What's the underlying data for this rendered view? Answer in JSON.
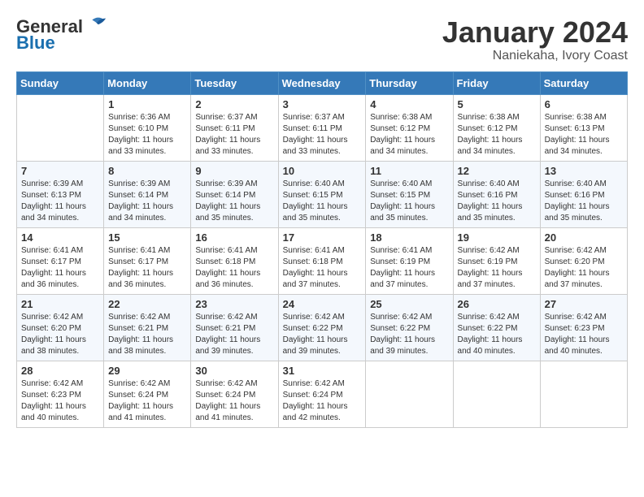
{
  "header": {
    "logo": {
      "general": "General",
      "blue": "Blue"
    },
    "title": "January 2024",
    "location": "Naniekaha, Ivory Coast"
  },
  "calendar": {
    "days_of_week": [
      "Sunday",
      "Monday",
      "Tuesday",
      "Wednesday",
      "Thursday",
      "Friday",
      "Saturday"
    ],
    "weeks": [
      [
        {
          "day": "",
          "info": ""
        },
        {
          "day": "1",
          "info": "Sunrise: 6:36 AM\nSunset: 6:10 PM\nDaylight: 11 hours\nand 33 minutes."
        },
        {
          "day": "2",
          "info": "Sunrise: 6:37 AM\nSunset: 6:11 PM\nDaylight: 11 hours\nand 33 minutes."
        },
        {
          "day": "3",
          "info": "Sunrise: 6:37 AM\nSunset: 6:11 PM\nDaylight: 11 hours\nand 33 minutes."
        },
        {
          "day": "4",
          "info": "Sunrise: 6:38 AM\nSunset: 6:12 PM\nDaylight: 11 hours\nand 34 minutes."
        },
        {
          "day": "5",
          "info": "Sunrise: 6:38 AM\nSunset: 6:12 PM\nDaylight: 11 hours\nand 34 minutes."
        },
        {
          "day": "6",
          "info": "Sunrise: 6:38 AM\nSunset: 6:13 PM\nDaylight: 11 hours\nand 34 minutes."
        }
      ],
      [
        {
          "day": "7",
          "info": "Sunrise: 6:39 AM\nSunset: 6:13 PM\nDaylight: 11 hours\nand 34 minutes."
        },
        {
          "day": "8",
          "info": "Sunrise: 6:39 AM\nSunset: 6:14 PM\nDaylight: 11 hours\nand 34 minutes."
        },
        {
          "day": "9",
          "info": "Sunrise: 6:39 AM\nSunset: 6:14 PM\nDaylight: 11 hours\nand 35 minutes."
        },
        {
          "day": "10",
          "info": "Sunrise: 6:40 AM\nSunset: 6:15 PM\nDaylight: 11 hours\nand 35 minutes."
        },
        {
          "day": "11",
          "info": "Sunrise: 6:40 AM\nSunset: 6:15 PM\nDaylight: 11 hours\nand 35 minutes."
        },
        {
          "day": "12",
          "info": "Sunrise: 6:40 AM\nSunset: 6:16 PM\nDaylight: 11 hours\nand 35 minutes."
        },
        {
          "day": "13",
          "info": "Sunrise: 6:40 AM\nSunset: 6:16 PM\nDaylight: 11 hours\nand 35 minutes."
        }
      ],
      [
        {
          "day": "14",
          "info": "Sunrise: 6:41 AM\nSunset: 6:17 PM\nDaylight: 11 hours\nand 36 minutes."
        },
        {
          "day": "15",
          "info": "Sunrise: 6:41 AM\nSunset: 6:17 PM\nDaylight: 11 hours\nand 36 minutes."
        },
        {
          "day": "16",
          "info": "Sunrise: 6:41 AM\nSunset: 6:18 PM\nDaylight: 11 hours\nand 36 minutes."
        },
        {
          "day": "17",
          "info": "Sunrise: 6:41 AM\nSunset: 6:18 PM\nDaylight: 11 hours\nand 37 minutes."
        },
        {
          "day": "18",
          "info": "Sunrise: 6:41 AM\nSunset: 6:19 PM\nDaylight: 11 hours\nand 37 minutes."
        },
        {
          "day": "19",
          "info": "Sunrise: 6:42 AM\nSunset: 6:19 PM\nDaylight: 11 hours\nand 37 minutes."
        },
        {
          "day": "20",
          "info": "Sunrise: 6:42 AM\nSunset: 6:20 PM\nDaylight: 11 hours\nand 37 minutes."
        }
      ],
      [
        {
          "day": "21",
          "info": "Sunrise: 6:42 AM\nSunset: 6:20 PM\nDaylight: 11 hours\nand 38 minutes."
        },
        {
          "day": "22",
          "info": "Sunrise: 6:42 AM\nSunset: 6:21 PM\nDaylight: 11 hours\nand 38 minutes."
        },
        {
          "day": "23",
          "info": "Sunrise: 6:42 AM\nSunset: 6:21 PM\nDaylight: 11 hours\nand 39 minutes."
        },
        {
          "day": "24",
          "info": "Sunrise: 6:42 AM\nSunset: 6:22 PM\nDaylight: 11 hours\nand 39 minutes."
        },
        {
          "day": "25",
          "info": "Sunrise: 6:42 AM\nSunset: 6:22 PM\nDaylight: 11 hours\nand 39 minutes."
        },
        {
          "day": "26",
          "info": "Sunrise: 6:42 AM\nSunset: 6:22 PM\nDaylight: 11 hours\nand 40 minutes."
        },
        {
          "day": "27",
          "info": "Sunrise: 6:42 AM\nSunset: 6:23 PM\nDaylight: 11 hours\nand 40 minutes."
        }
      ],
      [
        {
          "day": "28",
          "info": "Sunrise: 6:42 AM\nSunset: 6:23 PM\nDaylight: 11 hours\nand 40 minutes."
        },
        {
          "day": "29",
          "info": "Sunrise: 6:42 AM\nSunset: 6:24 PM\nDaylight: 11 hours\nand 41 minutes."
        },
        {
          "day": "30",
          "info": "Sunrise: 6:42 AM\nSunset: 6:24 PM\nDaylight: 11 hours\nand 41 minutes."
        },
        {
          "day": "31",
          "info": "Sunrise: 6:42 AM\nSunset: 6:24 PM\nDaylight: 11 hours\nand 42 minutes."
        },
        {
          "day": "",
          "info": ""
        },
        {
          "day": "",
          "info": ""
        },
        {
          "day": "",
          "info": ""
        }
      ]
    ]
  }
}
